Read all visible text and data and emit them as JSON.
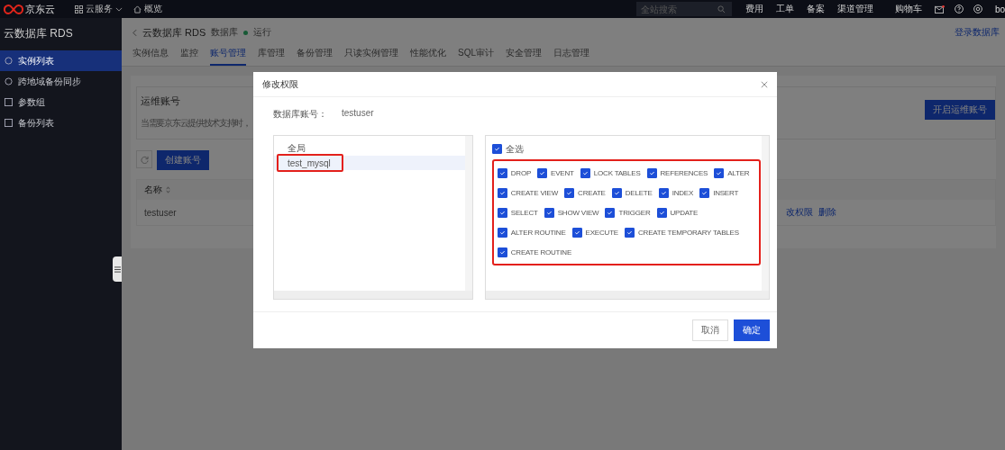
{
  "top_bar": {
    "logo": "京东云",
    "menu": "云服务",
    "overview": "概览",
    "search": {
      "placeholder": "全站搜索"
    },
    "links": [
      "费用",
      "工单",
      "备案",
      "渠道管理",
      "购物车"
    ],
    "user": "bo"
  },
  "sidebar": {
    "title": "云数据库 RDS",
    "items": [
      {
        "label": "实例列表",
        "selected": true
      },
      {
        "label": "跨地域备份同步",
        "selected": false
      },
      {
        "label": "参数组",
        "selected": false
      },
      {
        "label": "备份列表",
        "selected": false
      }
    ]
  },
  "header": {
    "title": "云数据库 RDS",
    "subtitle": "数据库",
    "status": "运行",
    "login_link": "登录数据库"
  },
  "tabs": [
    {
      "label": "实例信息",
      "selected": false
    },
    {
      "label": "监控",
      "selected": false
    },
    {
      "label": "账号管理",
      "selected": true
    },
    {
      "label": "库管理",
      "selected": false
    },
    {
      "label": "备份管理",
      "selected": false
    },
    {
      "label": "只读实例管理",
      "selected": false
    },
    {
      "label": "性能优化",
      "selected": false
    },
    {
      "label": "SQL审计",
      "selected": false
    },
    {
      "label": "安全管理",
      "selected": false
    },
    {
      "label": "日志管理",
      "selected": false
    }
  ],
  "ops_account": {
    "title": "运维账号",
    "description": "当需要京东云提供技术支持时，",
    "button": "开启运维账号"
  },
  "toolbar": {
    "create_button": "创建账号"
  },
  "table": {
    "columns": [
      "名称"
    ],
    "rows": [
      {
        "name": "testuser",
        "actions": [
          "改权限",
          "删除"
        ]
      }
    ]
  },
  "dialog": {
    "title": "修改权限",
    "account_label": "数据库账号：",
    "account": "testuser",
    "databases": [
      {
        "label": "全局",
        "selected": false,
        "highlighted": false
      },
      {
        "label": "test_mysql",
        "selected": true,
        "highlighted": true
      }
    ],
    "select_all": {
      "label": "全选",
      "checked": true
    },
    "privileges_highlighted": true,
    "privileges": [
      {
        "label": "DROP",
        "checked": true
      },
      {
        "label": "EVENT",
        "checked": true
      },
      {
        "label": "LOCK TABLES",
        "checked": true
      },
      {
        "label": "REFERENCES",
        "checked": true
      },
      {
        "label": "ALTER",
        "checked": true
      },
      {
        "label": "CREATE VIEW",
        "checked": true
      },
      {
        "label": "CREATE",
        "checked": true
      },
      {
        "label": "DELETE",
        "checked": true
      },
      {
        "label": "INDEX",
        "checked": true
      },
      {
        "label": "INSERT",
        "checked": true
      },
      {
        "label": "SELECT",
        "checked": true
      },
      {
        "label": "SHOW VIEW",
        "checked": true
      },
      {
        "label": "TRIGGER",
        "checked": true
      },
      {
        "label": "UPDATE",
        "checked": true
      },
      {
        "label": "ALTER ROUTINE",
        "checked": true
      },
      {
        "label": "EXECUTE",
        "checked": true
      },
      {
        "label": "CREATE TEMPORARY TABLES",
        "checked": true
      },
      {
        "label": "CREATE ROUTINE",
        "checked": true
      }
    ],
    "cancel_button": "取消",
    "ok_button": "确定"
  }
}
